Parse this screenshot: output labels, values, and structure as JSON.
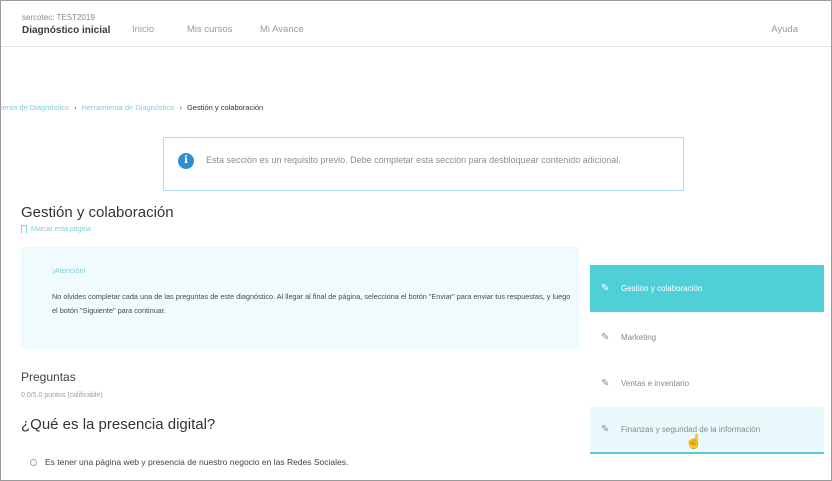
{
  "header": {
    "org": "sercotec: TEST2019",
    "course_title": "Diagnóstico inicial",
    "nav": [
      "Inicio",
      "Mis cursos",
      "Mi Avance"
    ],
    "help": "Ayuda"
  },
  "breadcrumb": {
    "items": [
      "ienta de Diagnóstico",
      "Herramienta de Diagnóstico"
    ],
    "separator": "›",
    "current": "Gestión y colaboración"
  },
  "notice": {
    "icon": "info-icon",
    "text": "Esta sección es un requisito previo. Debe completar esta sección para desbloquear contenido adicional."
  },
  "unit": {
    "title": "Gestión y colaboración",
    "bookmark": "Marcar esta página"
  },
  "attention": {
    "title": "¡Atención!",
    "text": "No olvides completar cada una de las preguntas de este diagnóstico. Al llegar al final de página, selecciona el botón \"Enviar\" para enviar tus respuestas, y luego el botón \"Siguiente\" para continuar."
  },
  "problem": {
    "title": "Preguntas",
    "points": "0.0/5.0 puntos (calificable)",
    "question": "¿Qué es la presencia digital?",
    "options": [
      "Es tener una página web y presencia de nuestro negocio en las Redes Sociales."
    ]
  },
  "sidebar": {
    "items": [
      {
        "label": "Gestión y colaboración",
        "icon": "edit-icon",
        "active": true
      },
      {
        "label": "Marketing",
        "icon": "edit-icon",
        "active": false
      },
      {
        "label": "Ventas e inventario",
        "icon": "edit-icon",
        "active": false
      },
      {
        "label": "Finanzas y seguridad de la información",
        "icon": "edit-icon",
        "active": false
      }
    ]
  },
  "colors": {
    "accent": "#4fd0d6",
    "link": "#7dd0e0",
    "info_icon": "#2f8fcf",
    "attention_bg": "#f0fbfd"
  }
}
